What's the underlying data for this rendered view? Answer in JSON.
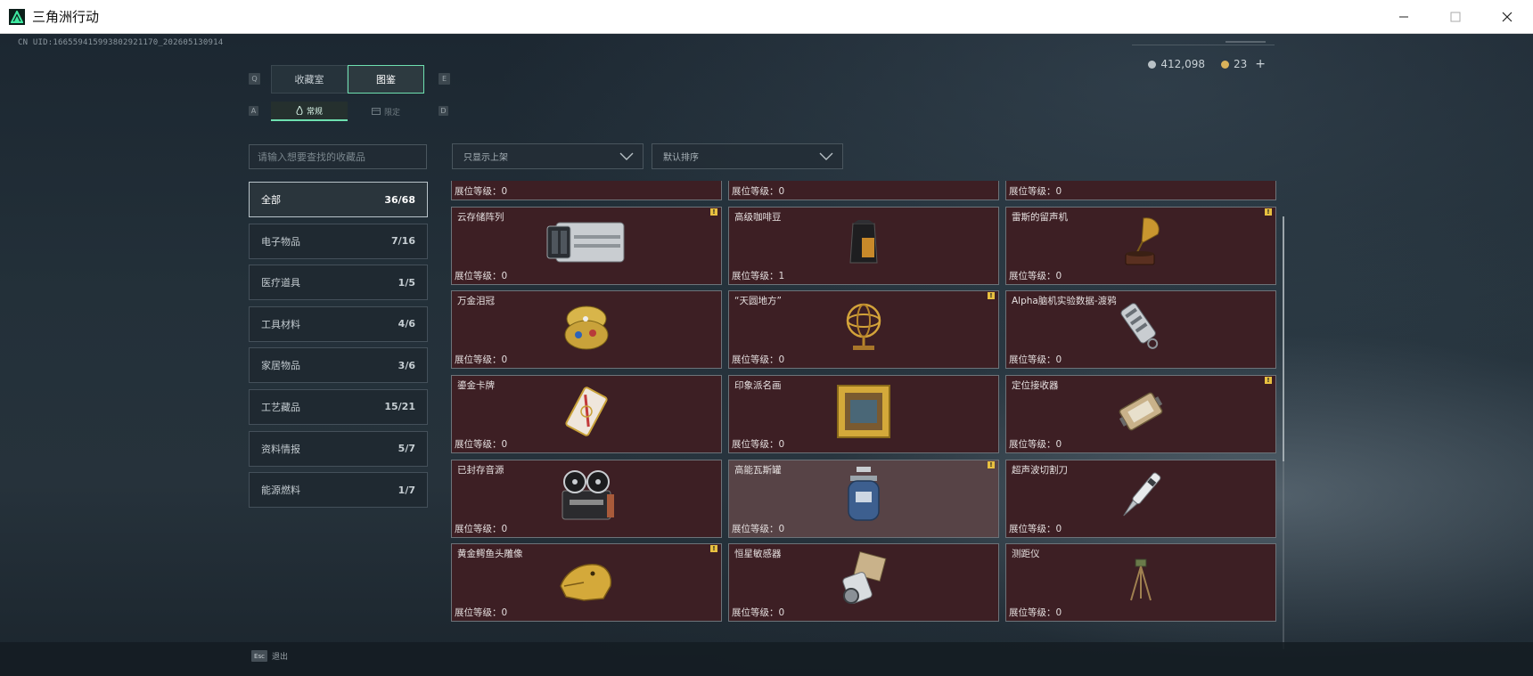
{
  "window": {
    "title": "三角洲行动",
    "minimize": "—",
    "maximize": "☐",
    "close": "✕"
  },
  "uid": "CN UID:1665594159938029​21170_202605130914",
  "currency": {
    "silver": "412,098",
    "gold": "23",
    "add": "+"
  },
  "tabs": [
    {
      "label": "收藏室"
    },
    {
      "label": "图鉴"
    }
  ],
  "tab_keys": {
    "left": "Q",
    "right": "E"
  },
  "subtabs": [
    {
      "label": "常规"
    },
    {
      "label": "限定"
    }
  ],
  "subtab_keys": {
    "left": "A",
    "right": "D"
  },
  "search": {
    "placeholder": "请输入想要查找的收藏品",
    "value": ""
  },
  "categories": [
    {
      "label": "全部",
      "count": "36/68"
    },
    {
      "label": "电子物品",
      "count": "7/16"
    },
    {
      "label": "医疗道具",
      "count": "1/5"
    },
    {
      "label": "工具材料",
      "count": "4/6"
    },
    {
      "label": "家居物品",
      "count": "3/6"
    },
    {
      "label": "工艺藏品",
      "count": "15/21"
    },
    {
      "label": "资料情报",
      "count": "5/7"
    },
    {
      "label": "能源燃料",
      "count": "1/7"
    }
  ],
  "filters": {
    "show": "只显示上架",
    "sort": "默认排序"
  },
  "level_label": "展位等级：",
  "items": [
    {
      "name": "",
      "level": "0",
      "badge": false
    },
    {
      "name": "",
      "level": "0",
      "badge": false
    },
    {
      "name": "",
      "level": "0",
      "badge": false
    },
    {
      "name": "云存储阵列",
      "level": "0",
      "badge": true
    },
    {
      "name": "高级咖啡豆",
      "level": "1",
      "badge": false
    },
    {
      "name": "雷斯的留声机",
      "level": "0",
      "badge": true
    },
    {
      "name": "万金泪冠",
      "level": "0",
      "badge": false
    },
    {
      "name": "“天圆地方”",
      "level": "0",
      "badge": true
    },
    {
      "name": "Alpha脑机实验数据-渡鸦",
      "level": "0",
      "badge": false
    },
    {
      "name": "鎏金卡牌",
      "level": "0",
      "badge": false
    },
    {
      "name": "印象派名画",
      "level": "0",
      "badge": false
    },
    {
      "name": "定位接收器",
      "level": "0",
      "badge": true
    },
    {
      "name": "已封存音源",
      "level": "0",
      "badge": false
    },
    {
      "name": "高能瓦斯罐",
      "level": "0",
      "badge": true
    },
    {
      "name": "超声波切割刀",
      "level": "0",
      "badge": false
    },
    {
      "name": "黄金鳄鱼头雕像",
      "level": "0",
      "badge": true
    },
    {
      "name": "恒星敏感器",
      "level": "0",
      "badge": false
    },
    {
      "name": "测距仪",
      "level": "0",
      "badge": false
    }
  ],
  "badge_symbol": "!",
  "bottom": {
    "esc_key": "Esc",
    "esc_label": "退出"
  }
}
